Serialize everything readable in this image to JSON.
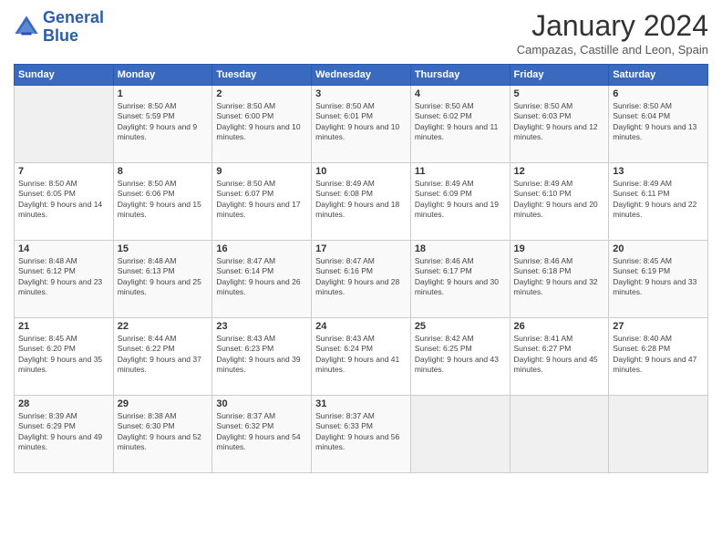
{
  "header": {
    "logo_line1": "General",
    "logo_line2": "Blue",
    "month": "January 2024",
    "location": "Campazas, Castille and Leon, Spain"
  },
  "weekdays": [
    "Sunday",
    "Monday",
    "Tuesday",
    "Wednesday",
    "Thursday",
    "Friday",
    "Saturday"
  ],
  "weeks": [
    [
      {
        "day": "",
        "sunrise": "",
        "sunset": "",
        "daylight": ""
      },
      {
        "day": "1",
        "sunrise": "Sunrise: 8:50 AM",
        "sunset": "Sunset: 5:59 PM",
        "daylight": "Daylight: 9 hours and 9 minutes."
      },
      {
        "day": "2",
        "sunrise": "Sunrise: 8:50 AM",
        "sunset": "Sunset: 6:00 PM",
        "daylight": "Daylight: 9 hours and 10 minutes."
      },
      {
        "day": "3",
        "sunrise": "Sunrise: 8:50 AM",
        "sunset": "Sunset: 6:01 PM",
        "daylight": "Daylight: 9 hours and 10 minutes."
      },
      {
        "day": "4",
        "sunrise": "Sunrise: 8:50 AM",
        "sunset": "Sunset: 6:02 PM",
        "daylight": "Daylight: 9 hours and 11 minutes."
      },
      {
        "day": "5",
        "sunrise": "Sunrise: 8:50 AM",
        "sunset": "Sunset: 6:03 PM",
        "daylight": "Daylight: 9 hours and 12 minutes."
      },
      {
        "day": "6",
        "sunrise": "Sunrise: 8:50 AM",
        "sunset": "Sunset: 6:04 PM",
        "daylight": "Daylight: 9 hours and 13 minutes."
      }
    ],
    [
      {
        "day": "7",
        "sunrise": "Sunrise: 8:50 AM",
        "sunset": "Sunset: 6:05 PM",
        "daylight": "Daylight: 9 hours and 14 minutes."
      },
      {
        "day": "8",
        "sunrise": "Sunrise: 8:50 AM",
        "sunset": "Sunset: 6:06 PM",
        "daylight": "Daylight: 9 hours and 15 minutes."
      },
      {
        "day": "9",
        "sunrise": "Sunrise: 8:50 AM",
        "sunset": "Sunset: 6:07 PM",
        "daylight": "Daylight: 9 hours and 17 minutes."
      },
      {
        "day": "10",
        "sunrise": "Sunrise: 8:49 AM",
        "sunset": "Sunset: 6:08 PM",
        "daylight": "Daylight: 9 hours and 18 minutes."
      },
      {
        "day": "11",
        "sunrise": "Sunrise: 8:49 AM",
        "sunset": "Sunset: 6:09 PM",
        "daylight": "Daylight: 9 hours and 19 minutes."
      },
      {
        "day": "12",
        "sunrise": "Sunrise: 8:49 AM",
        "sunset": "Sunset: 6:10 PM",
        "daylight": "Daylight: 9 hours and 20 minutes."
      },
      {
        "day": "13",
        "sunrise": "Sunrise: 8:49 AM",
        "sunset": "Sunset: 6:11 PM",
        "daylight": "Daylight: 9 hours and 22 minutes."
      }
    ],
    [
      {
        "day": "14",
        "sunrise": "Sunrise: 8:48 AM",
        "sunset": "Sunset: 6:12 PM",
        "daylight": "Daylight: 9 hours and 23 minutes."
      },
      {
        "day": "15",
        "sunrise": "Sunrise: 8:48 AM",
        "sunset": "Sunset: 6:13 PM",
        "daylight": "Daylight: 9 hours and 25 minutes."
      },
      {
        "day": "16",
        "sunrise": "Sunrise: 8:47 AM",
        "sunset": "Sunset: 6:14 PM",
        "daylight": "Daylight: 9 hours and 26 minutes."
      },
      {
        "day": "17",
        "sunrise": "Sunrise: 8:47 AM",
        "sunset": "Sunset: 6:16 PM",
        "daylight": "Daylight: 9 hours and 28 minutes."
      },
      {
        "day": "18",
        "sunrise": "Sunrise: 8:46 AM",
        "sunset": "Sunset: 6:17 PM",
        "daylight": "Daylight: 9 hours and 30 minutes."
      },
      {
        "day": "19",
        "sunrise": "Sunrise: 8:46 AM",
        "sunset": "Sunset: 6:18 PM",
        "daylight": "Daylight: 9 hours and 32 minutes."
      },
      {
        "day": "20",
        "sunrise": "Sunrise: 8:45 AM",
        "sunset": "Sunset: 6:19 PM",
        "daylight": "Daylight: 9 hours and 33 minutes."
      }
    ],
    [
      {
        "day": "21",
        "sunrise": "Sunrise: 8:45 AM",
        "sunset": "Sunset: 6:20 PM",
        "daylight": "Daylight: 9 hours and 35 minutes."
      },
      {
        "day": "22",
        "sunrise": "Sunrise: 8:44 AM",
        "sunset": "Sunset: 6:22 PM",
        "daylight": "Daylight: 9 hours and 37 minutes."
      },
      {
        "day": "23",
        "sunrise": "Sunrise: 8:43 AM",
        "sunset": "Sunset: 6:23 PM",
        "daylight": "Daylight: 9 hours and 39 minutes."
      },
      {
        "day": "24",
        "sunrise": "Sunrise: 8:43 AM",
        "sunset": "Sunset: 6:24 PM",
        "daylight": "Daylight: 9 hours and 41 minutes."
      },
      {
        "day": "25",
        "sunrise": "Sunrise: 8:42 AM",
        "sunset": "Sunset: 6:25 PM",
        "daylight": "Daylight: 9 hours and 43 minutes."
      },
      {
        "day": "26",
        "sunrise": "Sunrise: 8:41 AM",
        "sunset": "Sunset: 6:27 PM",
        "daylight": "Daylight: 9 hours and 45 minutes."
      },
      {
        "day": "27",
        "sunrise": "Sunrise: 8:40 AM",
        "sunset": "Sunset: 6:28 PM",
        "daylight": "Daylight: 9 hours and 47 minutes."
      }
    ],
    [
      {
        "day": "28",
        "sunrise": "Sunrise: 8:39 AM",
        "sunset": "Sunset: 6:29 PM",
        "daylight": "Daylight: 9 hours and 49 minutes."
      },
      {
        "day": "29",
        "sunrise": "Sunrise: 8:38 AM",
        "sunset": "Sunset: 6:30 PM",
        "daylight": "Daylight: 9 hours and 52 minutes."
      },
      {
        "day": "30",
        "sunrise": "Sunrise: 8:37 AM",
        "sunset": "Sunset: 6:32 PM",
        "daylight": "Daylight: 9 hours and 54 minutes."
      },
      {
        "day": "31",
        "sunrise": "Sunrise: 8:37 AM",
        "sunset": "Sunset: 6:33 PM",
        "daylight": "Daylight: 9 hours and 56 minutes."
      },
      {
        "day": "",
        "sunrise": "",
        "sunset": "",
        "daylight": ""
      },
      {
        "day": "",
        "sunrise": "",
        "sunset": "",
        "daylight": ""
      },
      {
        "day": "",
        "sunrise": "",
        "sunset": "",
        "daylight": ""
      }
    ]
  ]
}
